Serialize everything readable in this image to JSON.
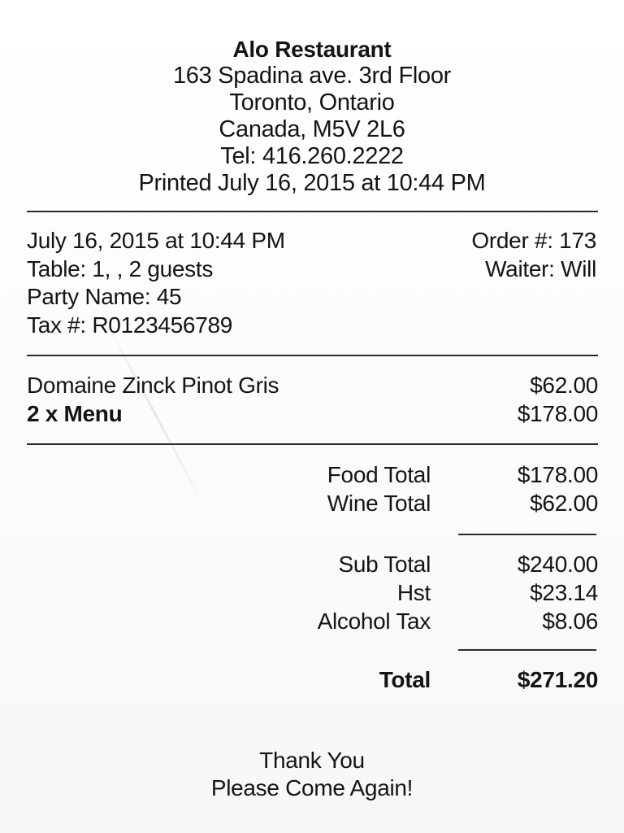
{
  "restaurant": {
    "name": "Alo Restaurant",
    "address_line1": "163 Spadina ave. 3rd Floor",
    "address_line2": "Toronto, Ontario",
    "address_line3": "Canada, M5V 2L6",
    "phone": "Tel: 416.260.2222",
    "printed": "Printed July 16, 2015 at 10:44 PM"
  },
  "order_info": {
    "datetime": "July 16, 2015 at 10:44 PM",
    "table": "Table: 1, , 2 guests",
    "party_name": "Party Name: 45",
    "tax_number": "Tax #: R0123456789",
    "order_number": "Order #: 173",
    "waiter": "Waiter: Will"
  },
  "items": [
    {
      "name": "Domaine Zinck Pinot Gris",
      "price": "$62.00",
      "bold": false
    },
    {
      "name": "2 x Menu",
      "price": "$178.00",
      "bold": true
    }
  ],
  "category_totals": [
    {
      "label": "Food Total",
      "value": "$178.00"
    },
    {
      "label": "Wine Total",
      "value": "$62.00"
    }
  ],
  "tax_lines": [
    {
      "label": "Sub Total",
      "value": "$240.00"
    },
    {
      "label": "Hst",
      "value": "$23.14"
    },
    {
      "label": "Alcohol Tax",
      "value": "$8.06"
    }
  ],
  "grand_total": {
    "label": "Total",
    "value": "$271.20"
  },
  "footer": {
    "line1": "Thank You",
    "line2": "Please Come Again!"
  }
}
